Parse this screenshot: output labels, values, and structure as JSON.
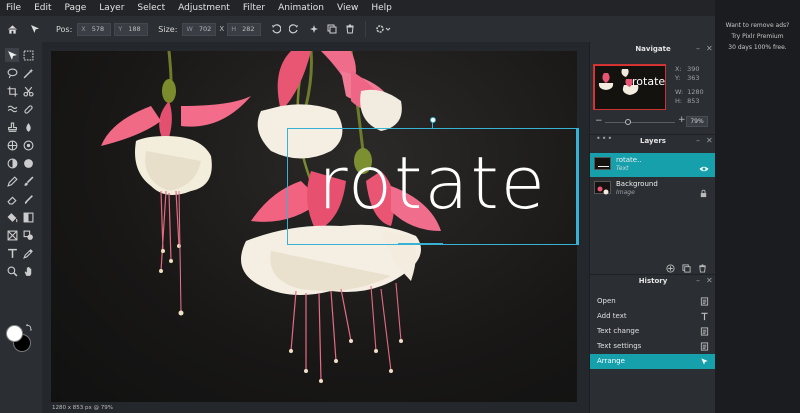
{
  "menu": [
    "File",
    "Edit",
    "Page",
    "Layer",
    "Select",
    "Adjustment",
    "Filter",
    "Animation",
    "View",
    "Help"
  ],
  "toolbar": {
    "pos_label": "Pos:",
    "x_key": "X",
    "x_value": "578",
    "y_key": "Y",
    "y_value": "188",
    "size_label": "Size:",
    "w_key": "W",
    "w_value": "702",
    "h_key": "H",
    "h_value": "282",
    "x_sep": "X"
  },
  "canvas": {
    "text": "rotate",
    "status": "1280 x 853 px @ 79%"
  },
  "navigate": {
    "title": "Navigate",
    "x_label": "X:",
    "x_value": "390",
    "y_label": "Y:",
    "y_value": "363",
    "w_label": "W:",
    "w_value": "1280",
    "h_label": "H:",
    "h_value": "853",
    "zoom": "79%",
    "zoom_fraction": 0.33,
    "minus": "−",
    "plus": "+"
  },
  "layers": {
    "title": "Layers",
    "items": [
      {
        "name": "rotate..",
        "type": "Text",
        "active": true
      },
      {
        "name": "Background",
        "type": "Image",
        "active": false
      }
    ]
  },
  "history": {
    "title": "History",
    "items": [
      {
        "label": "Open"
      },
      {
        "label": "Add text"
      },
      {
        "label": "Text change"
      },
      {
        "label": "Text settings"
      },
      {
        "label": "Arrange"
      }
    ]
  },
  "ad": {
    "line1": "Want to remove ads?",
    "line2": "Try Pixlr Premium",
    "line3": "30 days 100% free."
  },
  "colors": {
    "accent": "#15a0ac",
    "selection": "#38b2d4",
    "foreground": "#ffffff",
    "background": "#000000"
  }
}
